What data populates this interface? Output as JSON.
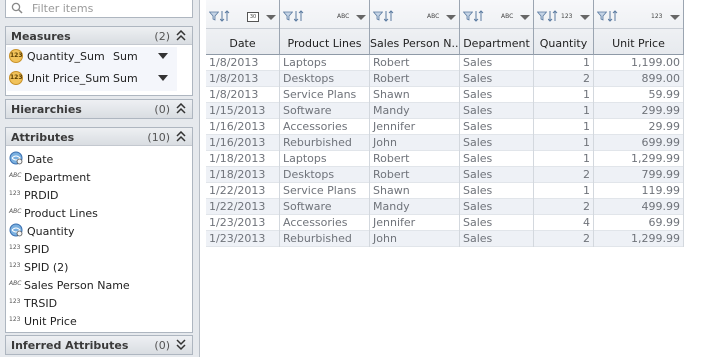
{
  "filter": {
    "placeholder": "Filter items",
    "icon": "search-icon"
  },
  "measures": {
    "title": "Measures",
    "count": "(2)",
    "items": [
      {
        "icon": "123",
        "name": "Quantity_Sum",
        "agg": "Sum"
      },
      {
        "icon": "123",
        "name": "Unit Price_Sum",
        "agg": "Sum"
      }
    ]
  },
  "hierarchies": {
    "title": "Hierarchies",
    "count": "(0)"
  },
  "attributes": {
    "title": "Attributes",
    "count": "(10)",
    "items": [
      {
        "type": "date-hierarchy",
        "name": "Date"
      },
      {
        "type": "abc",
        "type_label": "ABC",
        "name": "Department"
      },
      {
        "type": "123",
        "type_label": "123",
        "name": "PRDID"
      },
      {
        "type": "abc",
        "type_label": "ABC",
        "name": "Product Lines"
      },
      {
        "type": "hierarchy",
        "name": "Quantity"
      },
      {
        "type": "123",
        "type_label": "123",
        "name": "SPID"
      },
      {
        "type": "123",
        "type_label": "123",
        "name": "SPID (2)"
      },
      {
        "type": "abc",
        "type_label": "ABC",
        "name": "Sales Person Name"
      },
      {
        "type": "123",
        "type_label": "123",
        "name": "TRSID"
      },
      {
        "type": "123",
        "type_label": "123",
        "name": "Unit Price"
      }
    ]
  },
  "inferred": {
    "title": "Inferred Attributes",
    "count": "(0)"
  },
  "grid": {
    "columns": [
      {
        "title": "Date",
        "type_label": "30"
      },
      {
        "title": "Product Lines",
        "type_label": "ABC"
      },
      {
        "title": "Sales Person N...",
        "type_label": "ABC"
      },
      {
        "title": "Department",
        "type_label": "ABC"
      },
      {
        "title": "Quantity",
        "type_label": "123"
      },
      {
        "title": "Unit Price",
        "type_label": "123"
      }
    ],
    "rows": [
      [
        "1/8/2013",
        "Laptops",
        "Robert",
        "Sales",
        "1",
        "1,199.00"
      ],
      [
        "1/8/2013",
        "Desktops",
        "Robert",
        "Sales",
        "2",
        "899.00"
      ],
      [
        "1/8/2013",
        "Service Plans",
        "Shawn",
        "Sales",
        "1",
        "59.99"
      ],
      [
        "1/15/2013",
        "Software",
        "Mandy",
        "Sales",
        "1",
        "299.99"
      ],
      [
        "1/16/2013",
        "Accessories",
        "Jennifer",
        "Sales",
        "1",
        "29.99"
      ],
      [
        "1/16/2013",
        "Reburbished",
        "John",
        "Sales",
        "1",
        "699.99"
      ],
      [
        "1/18/2013",
        "Laptops",
        "Robert",
        "Sales",
        "1",
        "1,299.99"
      ],
      [
        "1/18/2013",
        "Desktops",
        "Robert",
        "Sales",
        "2",
        "799.99"
      ],
      [
        "1/22/2013",
        "Service Plans",
        "Shawn",
        "Sales",
        "1",
        "119.99"
      ],
      [
        "1/22/2013",
        "Software",
        "Mandy",
        "Sales",
        "2",
        "499.99"
      ],
      [
        "1/23/2013",
        "Accessories",
        "Jennifer",
        "Sales",
        "4",
        "69.99"
      ],
      [
        "1/23/2013",
        "Reburbished",
        "John",
        "Sales",
        "2",
        "1,299.99"
      ]
    ]
  },
  "colors": {
    "accent": "#3a6fb0",
    "badge": "#f1c25a"
  }
}
